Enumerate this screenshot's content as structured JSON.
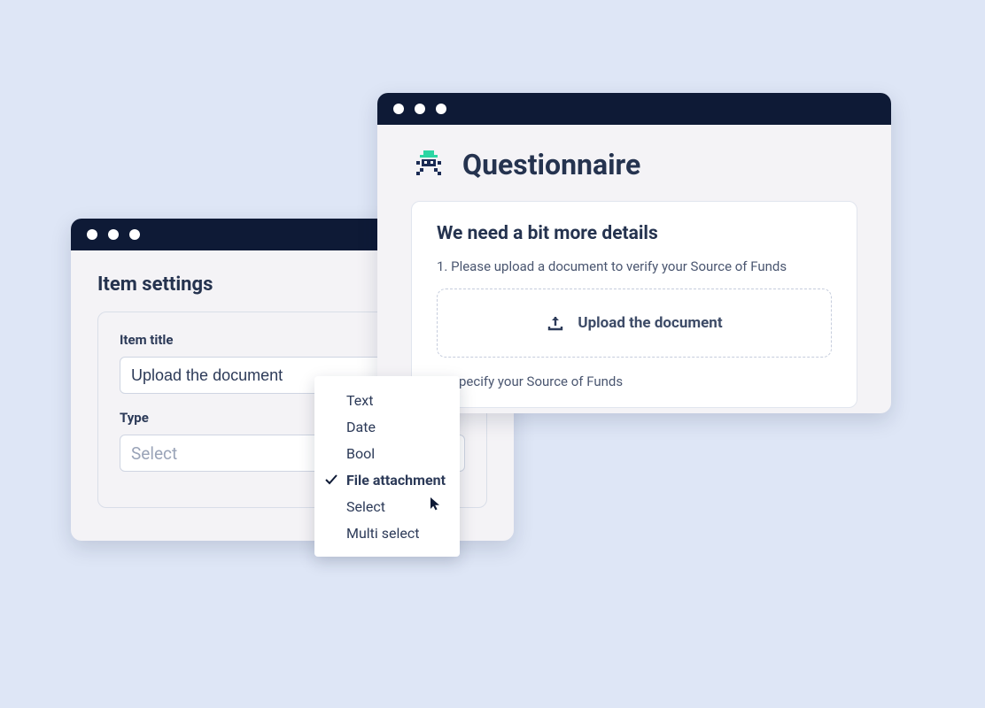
{
  "colors": {
    "bg": "#dee6f6",
    "titlebar": "#0e1a36",
    "text": "#2c3a58",
    "accent": "#2bd6a3"
  },
  "settings": {
    "title": "Item settings",
    "item_title_label": "Item title",
    "item_title_value": "Upload the document",
    "type_label": "Type",
    "type_placeholder": "Select",
    "type_options": [
      "Text",
      "Date",
      "Bool",
      "File attachment",
      "Select",
      "Multi select"
    ],
    "type_selected": "File attachment"
  },
  "questionnaire": {
    "title": "Questionnaire",
    "card_title": "We need a bit more details",
    "step1": "1. Please upload a document to verify your Source of Funds",
    "upload_label": "Upload the document",
    "step2": "2. Specify your Source of Funds"
  }
}
